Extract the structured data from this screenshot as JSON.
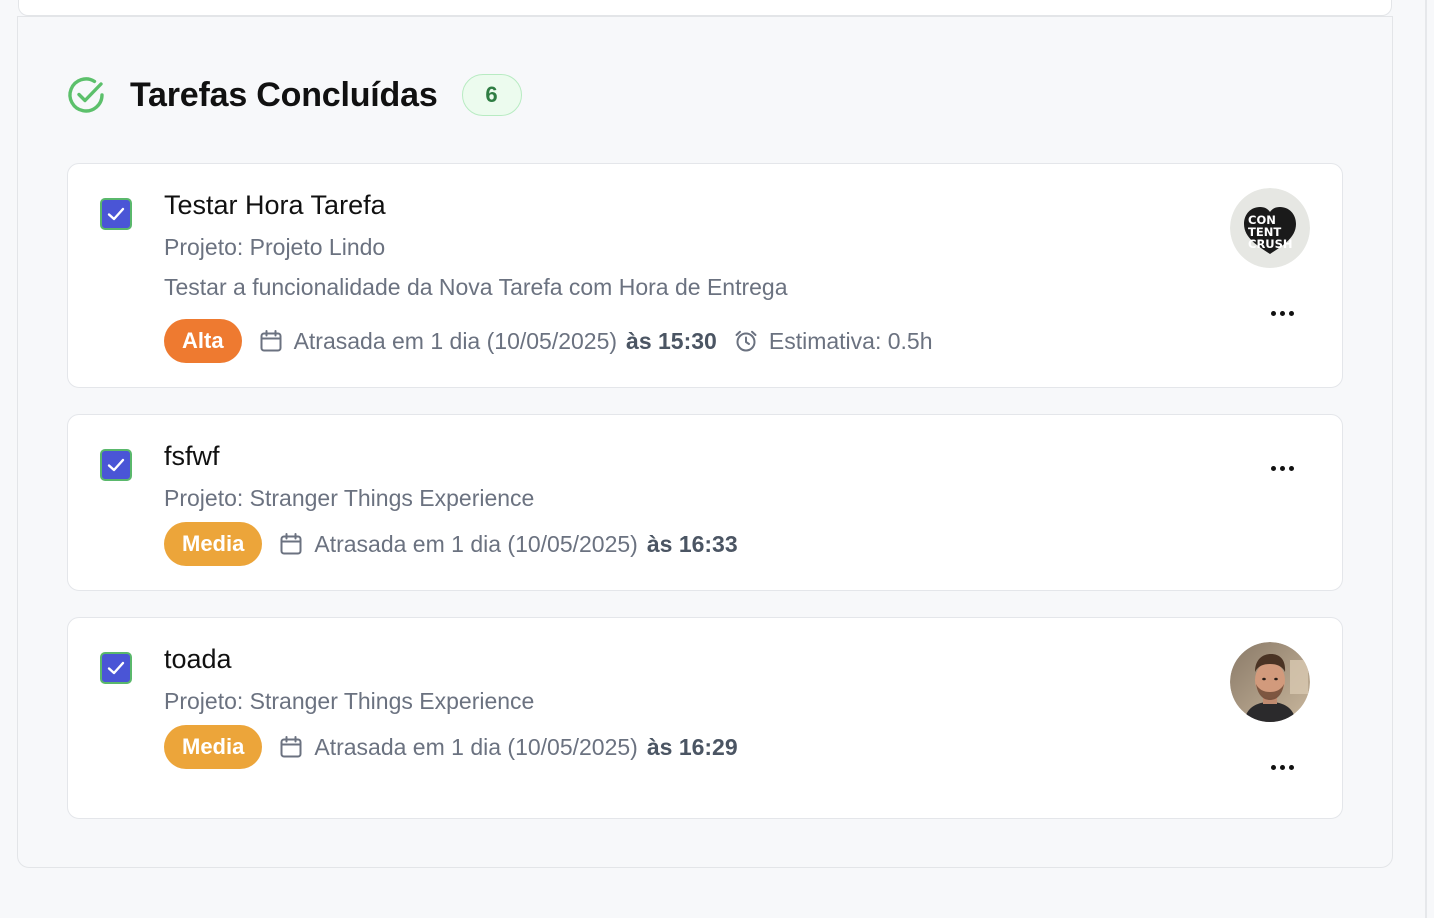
{
  "section": {
    "title": "Tarefas Concluídas",
    "count": "6",
    "icon": "check-circle-icon",
    "accent_color": "#5cc06b"
  },
  "tasks": [
    {
      "title": "Testar Hora Tarefa",
      "project": "Projeto: Projeto Lindo",
      "description": "Testar a funcionalidade da Nova Tarefa com Hora de Entrega",
      "priority": "Alta",
      "priority_color": "#ee7a30",
      "due_text": "Atrasada em 1 dia (10/05/2025)",
      "due_time": "às 15:30",
      "estimate": "Estimativa: 0.5h",
      "completed": true,
      "avatar": {
        "kind": "logo",
        "lines": [
          "CON",
          "TENT",
          "CRUSH"
        ]
      }
    },
    {
      "title": "fsfwf",
      "project": "Projeto: Stranger Things Experience",
      "priority": "Media",
      "priority_color": "#eca53a",
      "due_text": "Atrasada em 1 dia (10/05/2025)",
      "due_time": "às 16:33",
      "completed": true
    },
    {
      "title": "toada",
      "project": "Projeto: Stranger Things Experience",
      "priority": "Media",
      "priority_color": "#eca53a",
      "due_text": "Atrasada em 1 dia (10/05/2025)",
      "due_time": "às 16:29",
      "completed": true,
      "avatar": {
        "kind": "photo"
      }
    }
  ]
}
